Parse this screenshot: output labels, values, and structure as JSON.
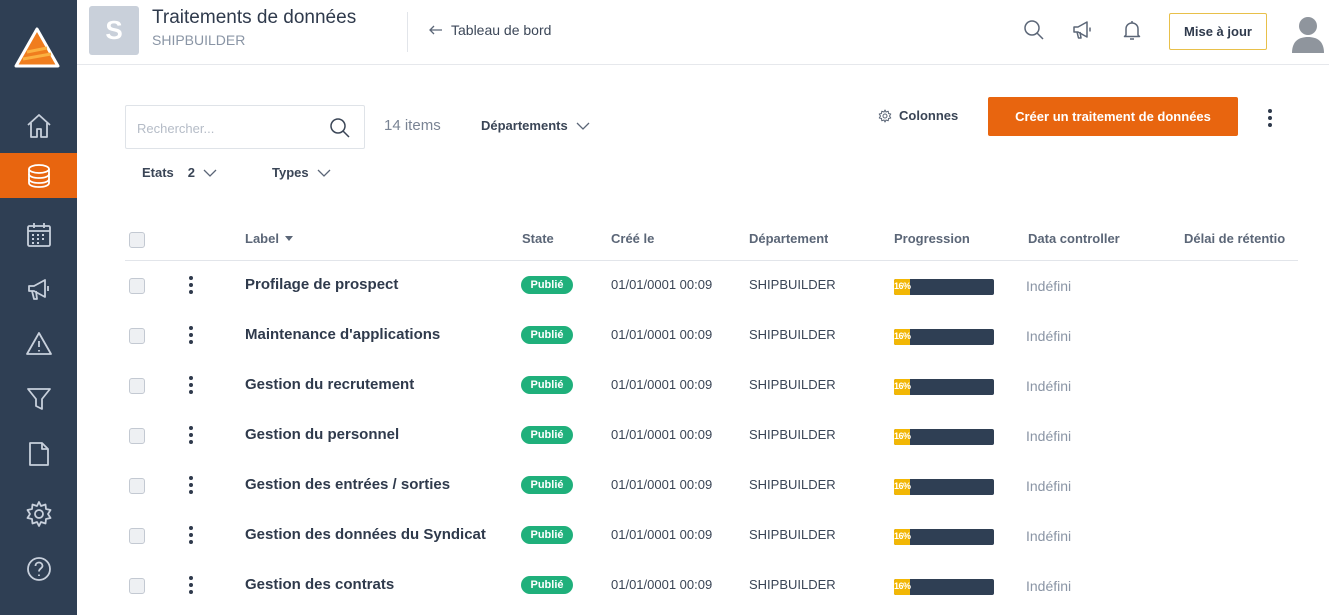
{
  "header": {
    "app_initial": "S",
    "title": "Traitements de données",
    "subtitle": "SHIPBUILDER",
    "back_link": "Tableau de bord",
    "icons": [
      "search-icon",
      "megaphone-icon",
      "bell-icon"
    ],
    "update_button": "Mise à jour"
  },
  "sidebar": {
    "items": [
      {
        "icon": "home-icon",
        "active": false
      },
      {
        "icon": "database-icon",
        "active": true
      },
      {
        "icon": "calendar-icon",
        "active": false
      },
      {
        "icon": "megaphone-icon",
        "active": false
      },
      {
        "icon": "warning-icon",
        "active": false
      },
      {
        "icon": "funnel-icon",
        "active": false
      },
      {
        "icon": "document-icon",
        "active": false
      },
      {
        "icon": "gear-icon",
        "active": false
      },
      {
        "icon": "help-icon",
        "active": false
      }
    ]
  },
  "toolbar": {
    "search_placeholder": "Rechercher...",
    "items_count": "14 items",
    "departments_filter": "Départements",
    "states_filter": "Etats",
    "states_count": "2",
    "types_filter": "Types",
    "columns_button": "Colonnes",
    "create_button": "Créer un traitement de données"
  },
  "table": {
    "columns": [
      "Label",
      "State",
      "Créé le",
      "Département",
      "Progression",
      "Data controller",
      "Délai de rétentio"
    ],
    "rows": [
      {
        "label": "Profilage de prospect",
        "state": "Publié",
        "created": "01/01/0001 00:09",
        "department": "SHIPBUILDER",
        "progress": 16,
        "progress_text": "16%",
        "controller": "Indéfini"
      },
      {
        "label": "Maintenance d'applications",
        "state": "Publié",
        "created": "01/01/0001 00:09",
        "department": "SHIPBUILDER",
        "progress": 16,
        "progress_text": "16%",
        "controller": "Indéfini"
      },
      {
        "label": "Gestion du recrutement",
        "state": "Publié",
        "created": "01/01/0001 00:09",
        "department": "SHIPBUILDER",
        "progress": 16,
        "progress_text": "16%",
        "controller": "Indéfini"
      },
      {
        "label": "Gestion du personnel",
        "state": "Publié",
        "created": "01/01/0001 00:09",
        "department": "SHIPBUILDER",
        "progress": 16,
        "progress_text": "16%",
        "controller": "Indéfini"
      },
      {
        "label": "Gestion des entrées / sorties",
        "state": "Publié",
        "created": "01/01/0001 00:09",
        "department": "SHIPBUILDER",
        "progress": 16,
        "progress_text": "16%",
        "controller": "Indéfini"
      },
      {
        "label": "Gestion des données du Syndicat",
        "state": "Publié",
        "created": "01/01/0001 00:09",
        "department": "SHIPBUILDER",
        "progress": 16,
        "progress_text": "16%",
        "controller": "Indéfini"
      },
      {
        "label": "Gestion des contrats",
        "state": "Publié",
        "created": "01/01/0001 00:09",
        "department": "SHIPBUILDER",
        "progress": 16,
        "progress_text": "16%",
        "controller": "Indéfini"
      }
    ]
  },
  "colors": {
    "accent": "#e8650f",
    "sidebar": "#2f3f54",
    "published": "#1fb07b",
    "progress_fill": "#f2b705",
    "update_border": "#e8c04a"
  }
}
